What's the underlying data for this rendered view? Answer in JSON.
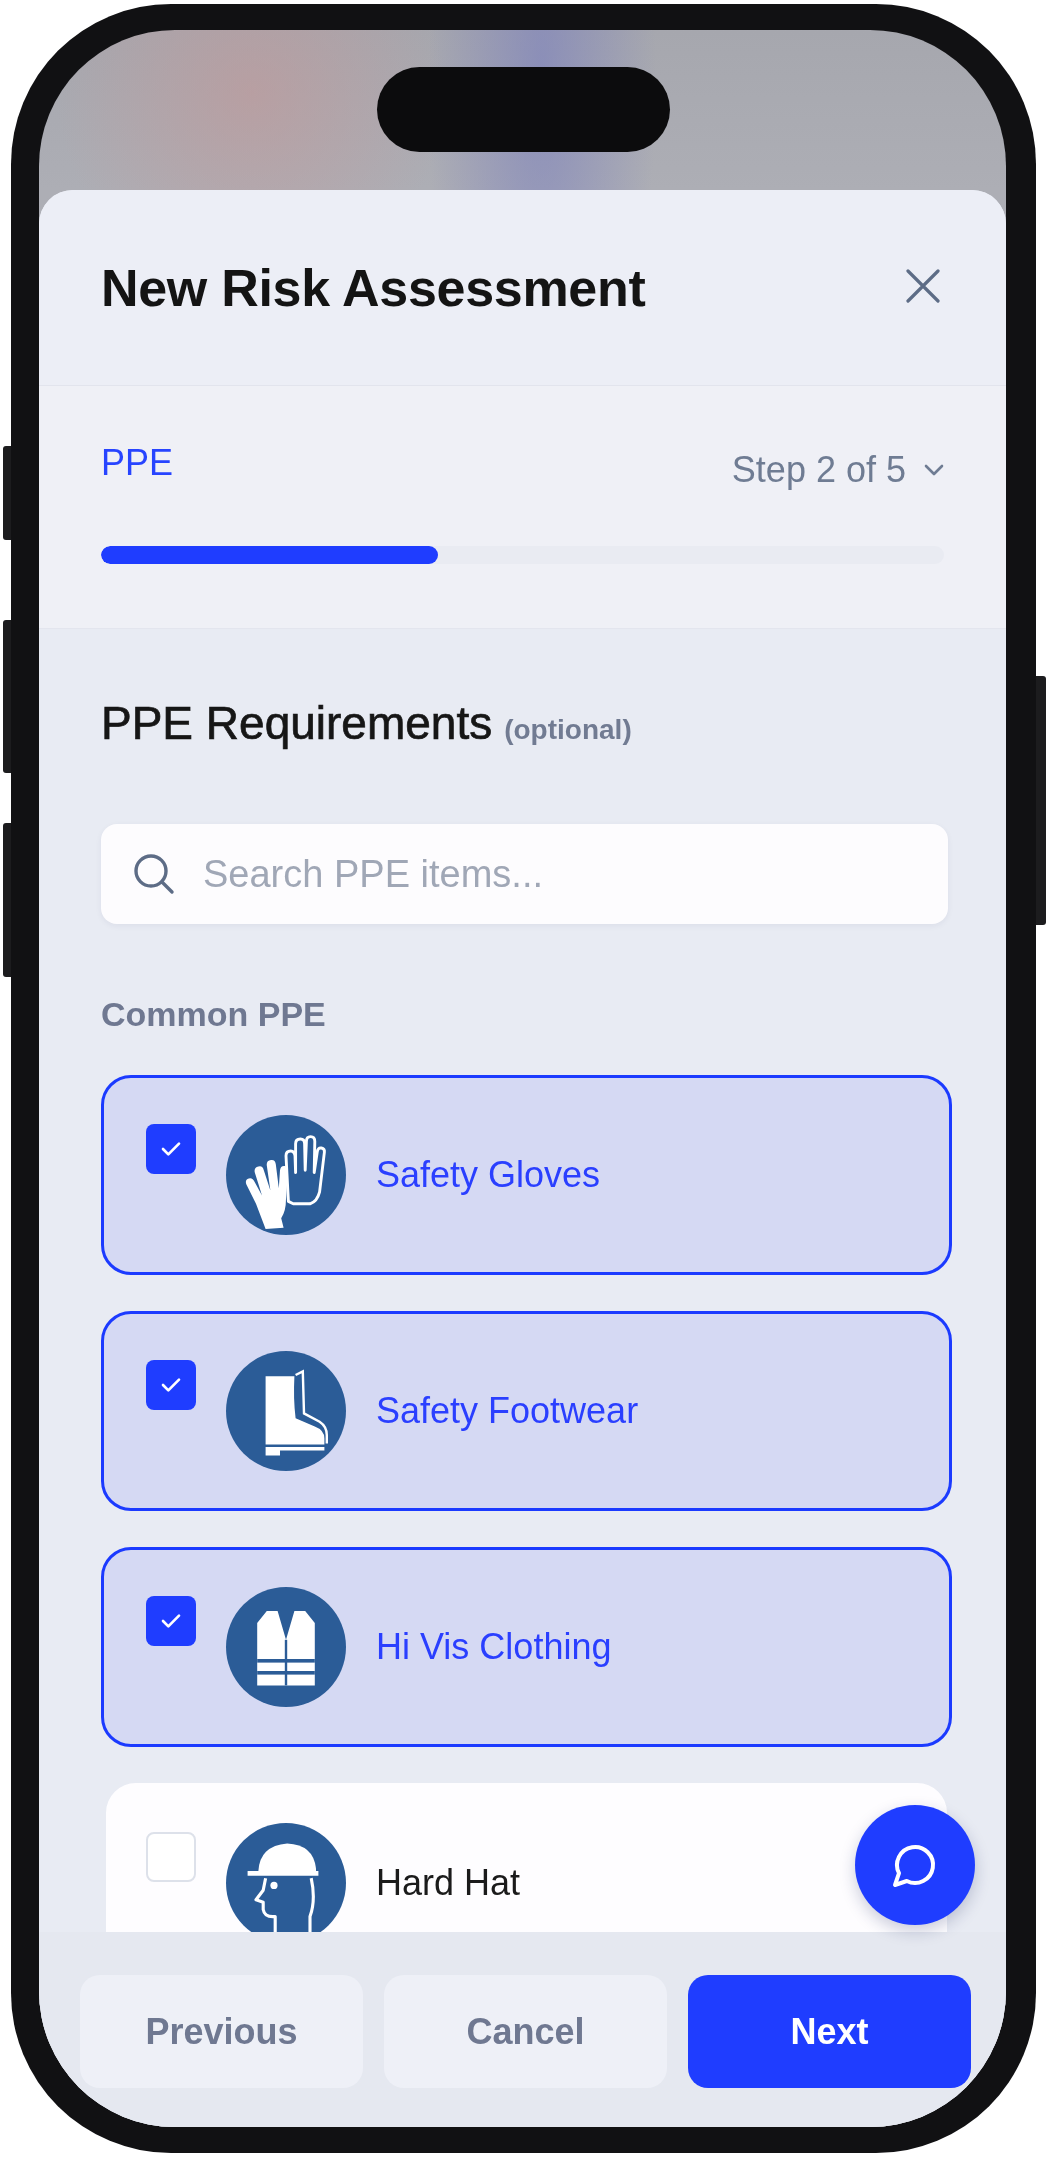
{
  "sheet": {
    "title": "New Risk Assessment"
  },
  "stepper": {
    "step_name": "PPE",
    "step_label": "Step 2 of 5",
    "level": 0.4
  },
  "section": {
    "heading": "PPE Requirements",
    "note": "(optional)"
  },
  "search": {
    "placeholder": "Search PPE items..."
  },
  "group_label": "Common PPE",
  "ppe_items": [
    {
      "label": "Safety Gloves",
      "checked": true
    },
    {
      "label": "Safety Footwear",
      "checked": true
    },
    {
      "label": "Hi Vis Clothing",
      "checked": true
    },
    {
      "label": "Hard Hat",
      "checked": false
    }
  ],
  "buttons": [
    {
      "label": "Previous",
      "kind": "secondary"
    },
    {
      "label": "Cancel",
      "kind": "secondary"
    },
    {
      "label": "Next",
      "kind": "primary"
    }
  ]
}
